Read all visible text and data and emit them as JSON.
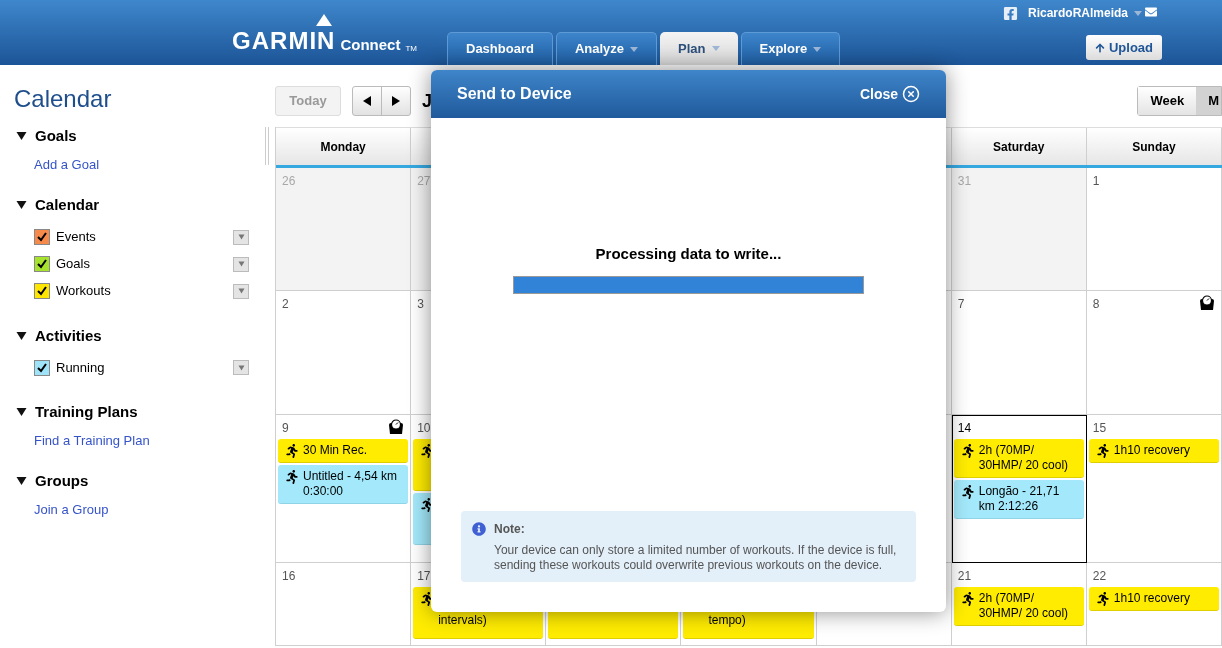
{
  "header": {
    "logo": "GARMIN",
    "logo_sub": "Connect",
    "logo_tm": "TM",
    "tabs": [
      {
        "label": "Dashboard",
        "selected": false,
        "caret": false
      },
      {
        "label": "Analyze",
        "selected": false,
        "caret": true
      },
      {
        "label": "Plan",
        "selected": true,
        "caret": true
      },
      {
        "label": "Explore",
        "selected": false,
        "caret": true
      }
    ],
    "user": "RicardoRAlmeida",
    "upload": "Upload"
  },
  "sidebar": {
    "title": "Calendar",
    "sections": [
      {
        "title": "Goals",
        "expanded": true,
        "link": "Add a Goal"
      },
      {
        "title": "Calendar",
        "expanded": true,
        "filters": [
          {
            "label": "Events",
            "checked": true,
            "color": "#f58a4b"
          },
          {
            "label": "Goals",
            "checked": true,
            "color": "#a6e22e"
          },
          {
            "label": "Workouts",
            "checked": true,
            "color": "#ffe600"
          }
        ]
      },
      {
        "title": "Activities",
        "expanded": true,
        "filters": [
          {
            "label": "Running",
            "checked": true,
            "color": "#9ee3f7"
          }
        ]
      },
      {
        "title": "Training Plans",
        "expanded": true,
        "link": "Find a Training Plan"
      },
      {
        "title": "Groups",
        "expanded": true,
        "link": "Join a Group"
      }
    ]
  },
  "toolbar": {
    "today": "Today",
    "today_disabled": true,
    "month": "J",
    "views": [
      {
        "label": "Week",
        "selected": false
      },
      {
        "label": "M",
        "selected": true
      }
    ]
  },
  "calendar": {
    "headers_left": [
      "Monday"
    ],
    "headers_right": [
      "Saturday",
      "Sunday"
    ],
    "weeks": [
      {
        "cells": [
          {
            "day": "26",
            "muted": true
          },
          {
            "day": "27",
            "muted": true
          },
          {},
          {},
          {},
          {
            "day": "31",
            "muted": true
          },
          {
            "day": "1",
            "muted": false
          }
        ]
      },
      {
        "cells": [
          {
            "day": "2",
            "muted": false
          },
          {
            "day": "3",
            "muted": false
          },
          {},
          {},
          {},
          {
            "day": "7",
            "muted": false
          },
          {
            "day": "8",
            "muted": false,
            "weigh_in": true
          }
        ]
      },
      {
        "cells": [
          {
            "day": "9",
            "muted": false,
            "weigh_in": true,
            "events": [
              {
                "kind": "workout",
                "text": "30 Min Rec."
              },
              {
                "kind": "activity",
                "text": "Untitled - 4,54 km 0:30:00"
              }
            ]
          },
          {
            "day": "10",
            "muted": false,
            "events": [
              {
                "kind": "workout",
                "clipped": true
              },
              {
                "kind": "activity",
                "clipped": true
              }
            ]
          },
          {},
          {},
          {},
          {
            "day": "14",
            "muted": false,
            "today": true,
            "events": [
              {
                "kind": "workout",
                "text": "2h (70MP/ 30HMP/ 20 cool)"
              },
              {
                "kind": "activity",
                "text": "Longão - 21,71 km 2:12:26"
              }
            ]
          },
          {
            "day": "15",
            "muted": false,
            "events": [
              {
                "kind": "workout",
                "text": "1h10 recovery"
              }
            ]
          }
        ]
      },
      {
        "cells": [
          {
            "day": "16",
            "muted": false
          },
          {
            "day": "17",
            "muted": false,
            "events": [
              {
                "kind": "workout",
                "text": "intervals)",
                "clipped": true
              }
            ]
          },
          {
            "events": [
              {
                "kind": "workout",
                "clipped": true
              }
            ]
          },
          {
            "events": [
              {
                "kind": "workout",
                "text": "tempo)",
                "clipped": true
              }
            ]
          },
          {},
          {
            "day": "21",
            "muted": false,
            "events": [
              {
                "kind": "workout",
                "text": "2h (70MP/ 30HMP/ 20 cool)"
              }
            ]
          },
          {
            "day": "22",
            "muted": false,
            "events": [
              {
                "kind": "workout",
                "text": "1h10 recovery"
              }
            ]
          }
        ]
      }
    ]
  },
  "dialog": {
    "title": "Send to Device",
    "close": "Close",
    "status": "Processing data to write...",
    "progress": {
      "level": 1
    },
    "note": {
      "title": "Note:",
      "text": "Your device can only store a limited number of workouts. If the device is full, sending these workouts could overwrite previous workouts on the device."
    }
  }
}
